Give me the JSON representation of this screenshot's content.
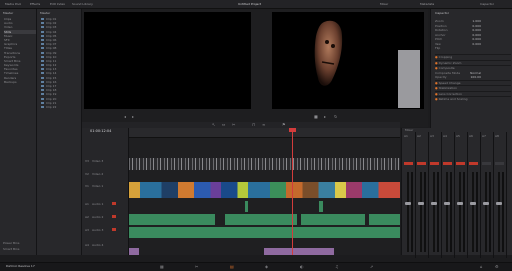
{
  "topbar": {
    "left_items": [
      "Media Pool",
      "Effects",
      "Edit Index",
      "Sound Library"
    ],
    "center_title": "Untitled Project",
    "right_items": [
      "Mixer",
      "Metadata",
      "Inspector"
    ]
  },
  "left_panel": {
    "tree_header": "Master",
    "tree_items": [
      "Clips",
      "Audio",
      "Video",
      "Stills",
      "Music",
      "SFX",
      "Graphics",
      "Titles",
      "Transitions",
      "Exports",
      "Smart Bins",
      "Keywords",
      "Favorites",
      "Timelines",
      "Renders",
      "Backups"
    ],
    "media_header": "Master",
    "media_items": [
      "Clip 01",
      "Clip 02",
      "Clip 03",
      "Clip 04",
      "Clip 05",
      "Clip 06",
      "Clip 07",
      "Clip 08",
      "Clip 09",
      "Clip 10",
      "Clip 11",
      "Clip 12",
      "Clip 13",
      "Clip 14",
      "Clip 15",
      "Clip 16",
      "Clip 17",
      "Clip 18",
      "Clip 19",
      "Clip 20",
      "Clip 21",
      "Clip 22"
    ],
    "bottom_items": [
      "Power Bins",
      "Smart Bins"
    ],
    "project_name": "Project Name"
  },
  "timeline": {
    "timecode": "01:00:12:04",
    "tracks": [
      {
        "id": "V3",
        "label": "Video 3"
      },
      {
        "id": "V2",
        "label": "Video 2"
      },
      {
        "id": "V1",
        "label": "Video 1"
      },
      {
        "id": "A1",
        "label": "Audio 1"
      },
      {
        "id": "A2",
        "label": "Audio 2"
      },
      {
        "id": "A3",
        "label": "Audio 3"
      },
      {
        "id": "A4",
        "label": "Audio 4"
      }
    ],
    "playhead_color": "#d23c3c"
  },
  "inspector": {
    "title": "Inspector",
    "rows": [
      {
        "label": "Zoom",
        "value": "1.000"
      },
      {
        "label": "Position",
        "value": "0.000"
      },
      {
        "label": "Rotation",
        "value": "0.000"
      },
      {
        "label": "Anchor",
        "value": "0.000"
      },
      {
        "label": "Pitch",
        "value": "0.000"
      },
      {
        "label": "Yaw",
        "value": "0.000"
      },
      {
        "label": "Flip",
        "value": ""
      }
    ],
    "sections": [
      "Cropping",
      "Dynamic Zoom",
      "Composite",
      "Speed Change",
      "Stabilization",
      "Lens Correction",
      "Retime and Scaling"
    ],
    "composite_mode_label": "Composite Mode",
    "composite_mode_value": "Normal",
    "opacity_label": "Opacity",
    "opacity_value": "100.00"
  },
  "mixer": {
    "title": "Mixer",
    "channels": [
      "A1",
      "A2",
      "A3",
      "A4",
      "A5",
      "A6",
      "A7",
      "A8",
      "M1"
    ]
  },
  "bottom_nav": {
    "app_name": "DaVinci Resolve 17",
    "pages": [
      "media-icon",
      "cut-icon",
      "edit-icon",
      "fusion-icon",
      "color-icon",
      "fairlight-icon",
      "deliver-icon"
    ]
  },
  "colors": {
    "video_clip": "#3c7fa0",
    "audio_green": "#3a8a5e",
    "audio_purple": "#8f6aa0",
    "accent_orange": "#e0742a"
  }
}
